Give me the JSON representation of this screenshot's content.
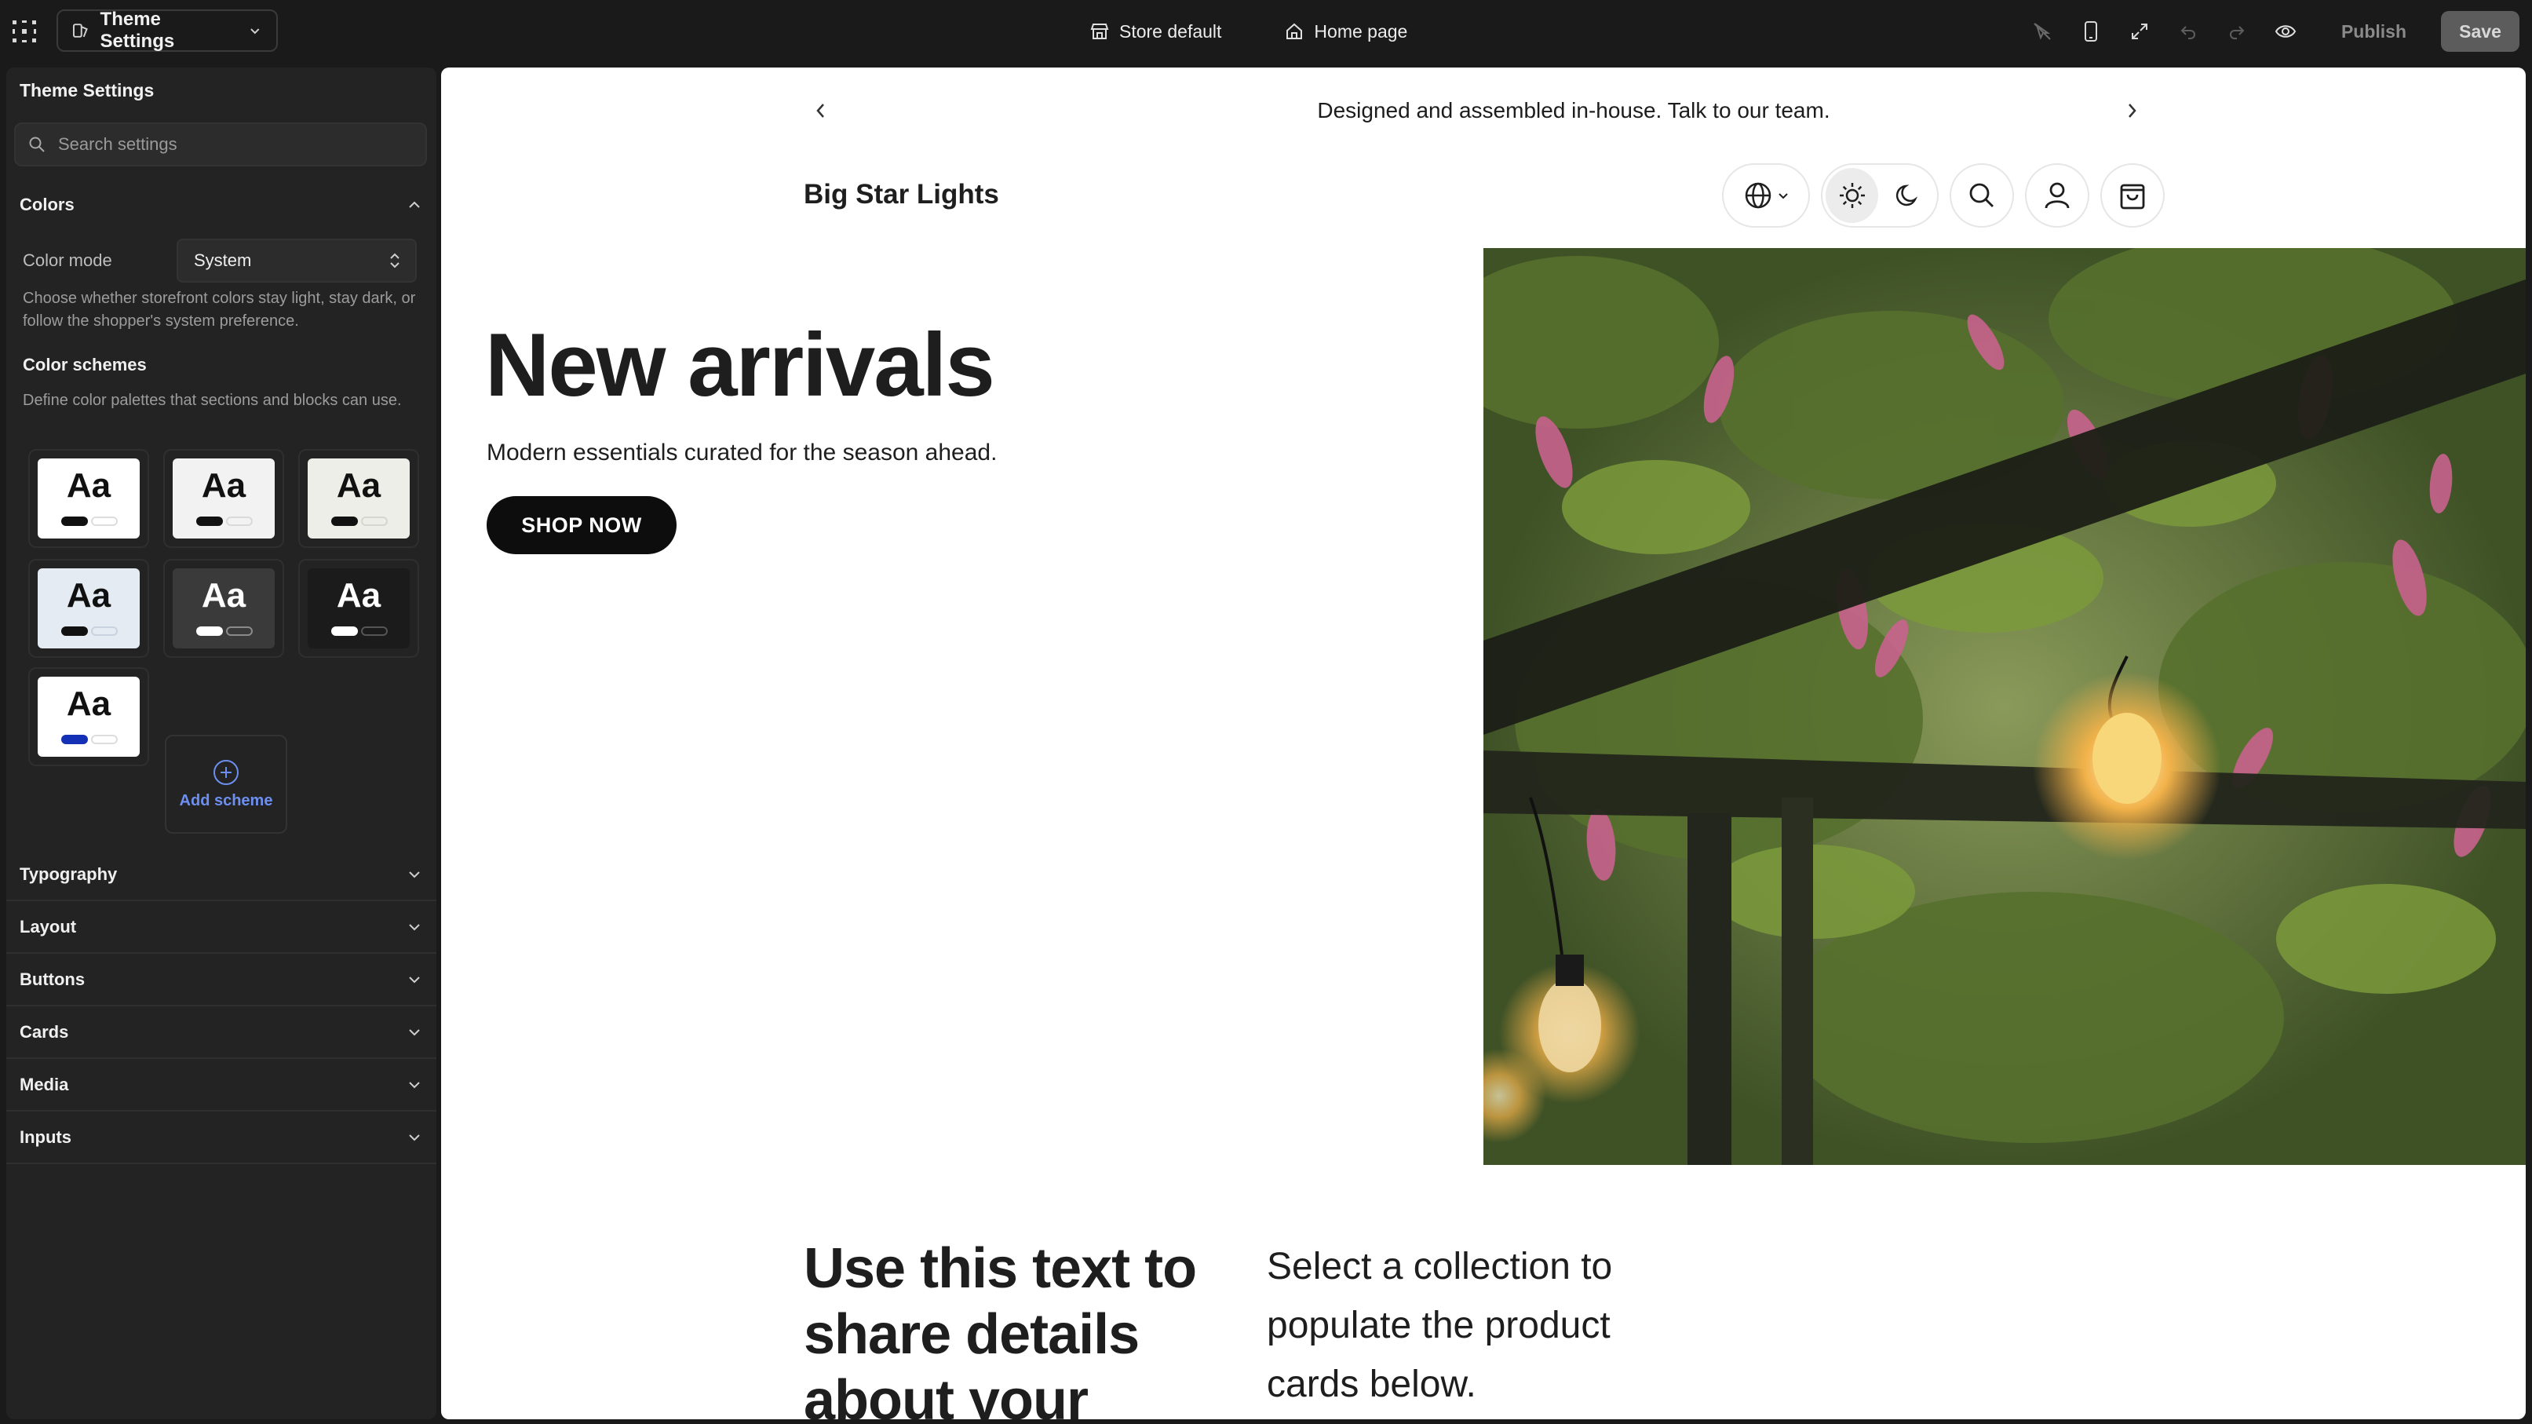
{
  "topbar": {
    "theme_label": "Theme Settings",
    "store_label": "Store default",
    "page_label": "Home page",
    "publish_label": "Publish",
    "save_label": "Save"
  },
  "sidebar": {
    "title": "Theme Settings",
    "search_placeholder": "Search settings",
    "colors": {
      "label": "Colors",
      "mode_label": "Color mode",
      "mode_value": "System",
      "mode_help": "Choose whether storefront colors stay light, stay dark, or follow the shopper's system preference.",
      "schemes_title": "Color schemes",
      "schemes_help": "Define color palettes that sections and blocks can use.",
      "add_scheme_label": "Add scheme",
      "swatch_text": "Aa",
      "schemes": [
        {
          "bg": "#ffffff",
          "fg": "#111111",
          "pill_a": "#111111",
          "pill_b": "#ffffff",
          "pill_b_border": "#dddddd"
        },
        {
          "bg": "#f2f2f2",
          "fg": "#111111",
          "pill_a": "#111111",
          "pill_b": "#f2f2f2",
          "pill_b_border": "#d9d9d9"
        },
        {
          "bg": "#eeeee8",
          "fg": "#111111",
          "pill_a": "#111111",
          "pill_b": "#eeeee8",
          "pill_b_border": "#d6d6cf"
        },
        {
          "bg": "#e4ebf3",
          "fg": "#111111",
          "pill_a": "#111111",
          "pill_b": "#e4ebf3",
          "pill_b_border": "#c9d3df"
        },
        {
          "bg": "#3a3a3a",
          "fg": "#ffffff",
          "pill_a": "#ffffff",
          "pill_b": "#3a3a3a",
          "pill_b_border": "#8a8a8a"
        },
        {
          "bg": "#1b1b1b",
          "fg": "#ffffff",
          "pill_a": "#ffffff",
          "pill_b": "#1b1b1b",
          "pill_b_border": "#555555"
        },
        {
          "bg": "#ffffff",
          "fg": "#111111",
          "pill_a": "#1430b5",
          "pill_b": "#ffffff",
          "pill_b_border": "#dddddd"
        }
      ]
    },
    "sections": [
      {
        "label": "Typography"
      },
      {
        "label": "Layout"
      },
      {
        "label": "Buttons"
      },
      {
        "label": "Cards"
      },
      {
        "label": "Media"
      },
      {
        "label": "Inputs"
      }
    ]
  },
  "preview": {
    "announcement": "Designed and assembled in-house. Talk to our team.",
    "brand": "Big Star Lights",
    "hero_title": "New arrivals",
    "hero_subtitle": "Modern essentials curated for the season ahead.",
    "hero_button": "SHOP NOW",
    "bottom_left": "Use this text to share details about your",
    "bottom_right": "Select a collection to populate the product cards below."
  },
  "colors": {
    "editor_bg": "#1a1a1a",
    "panel_bg": "#232323",
    "accent": "#6d8ff0"
  }
}
